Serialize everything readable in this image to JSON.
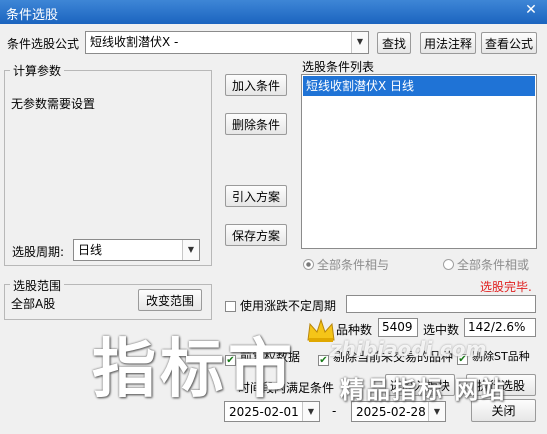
{
  "window": {
    "title": "条件选股",
    "close_glyph": "✕"
  },
  "formula": {
    "label": "条件选股公式",
    "value": "短线收割潜伏X  -",
    "find_btn": "查找",
    "usage_btn": "用法注释",
    "view_btn": "查看公式"
  },
  "params": {
    "title": "计算参数",
    "empty_text": "无参数需要设置",
    "period_label": "选股周期:",
    "period_value": "日线"
  },
  "actions": {
    "add": "加入条件",
    "delete": "删除条件",
    "import": "引入方案",
    "save": "保存方案"
  },
  "conditions": {
    "title": "选股条件列表",
    "items": [
      "短线收割潜伏X  日线"
    ]
  },
  "logic": {
    "and_label": "全部条件相与",
    "or_label": "全部条件相或"
  },
  "status": {
    "done": "选股完毕."
  },
  "scope": {
    "title": "选股范围",
    "value": "全部A股",
    "change_btn": "改变范围"
  },
  "options": {
    "use_variable_period": "使用涨跌不定周期",
    "total_label": "品种数",
    "total_value": "5409",
    "selected_label": "选中数",
    "selected_value": "142/2.6%",
    "adjust_label": "前复权数据",
    "trading_days_label": "剔除当前未交易的品种",
    "st_label": "剔除ST品种"
  },
  "time_range": {
    "label": "时间段内满足条件",
    "start": "2025-02-01",
    "sep": "-",
    "end": "2025-02-28"
  },
  "bottom": {
    "to_board_btn": "选股入板块",
    "run_btn": "执行选股",
    "close_btn": "关闭"
  },
  "watermark": {
    "big": "指标市",
    "small": "精品指标 网站",
    "url": "zhibiaodi.com"
  }
}
